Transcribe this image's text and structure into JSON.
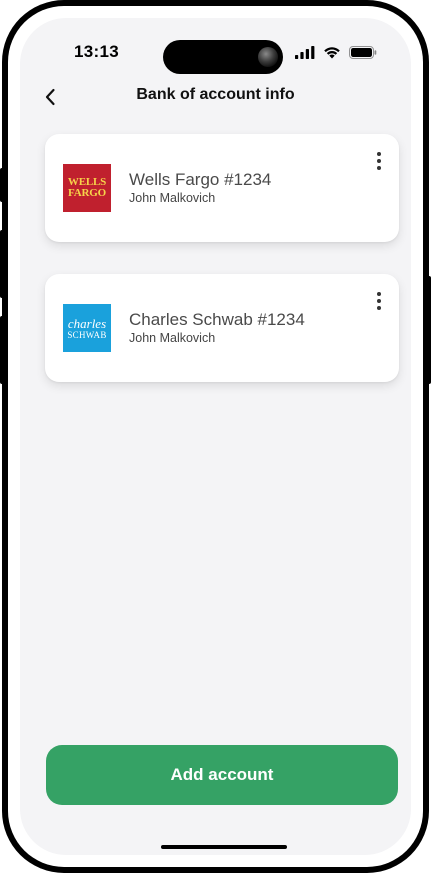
{
  "status_bar": {
    "time": "13:13",
    "icons": [
      "signal-icon",
      "wifi-icon",
      "battery-icon"
    ]
  },
  "header": {
    "title": "Bank of account info",
    "back_icon": "chevron-left-icon"
  },
  "accounts": [
    {
      "name": "Wells Fargo #1234",
      "holder": "John Malkovich",
      "logo_lines": [
        "WELLS",
        "FARGO"
      ],
      "logo_color": "#c0202e",
      "logo_text_color": "#f6d24a"
    },
    {
      "name": "Charles Schwab #1234",
      "holder": "John Malkovich",
      "logo_lines": [
        "charles",
        "SCHWAB"
      ],
      "logo_color": "#1aa1dc",
      "logo_text_color": "#ffffff"
    }
  ],
  "actions": {
    "add_account_label": "Add account"
  },
  "colors": {
    "accent": "#35a265",
    "background": "#f4f4f6"
  }
}
